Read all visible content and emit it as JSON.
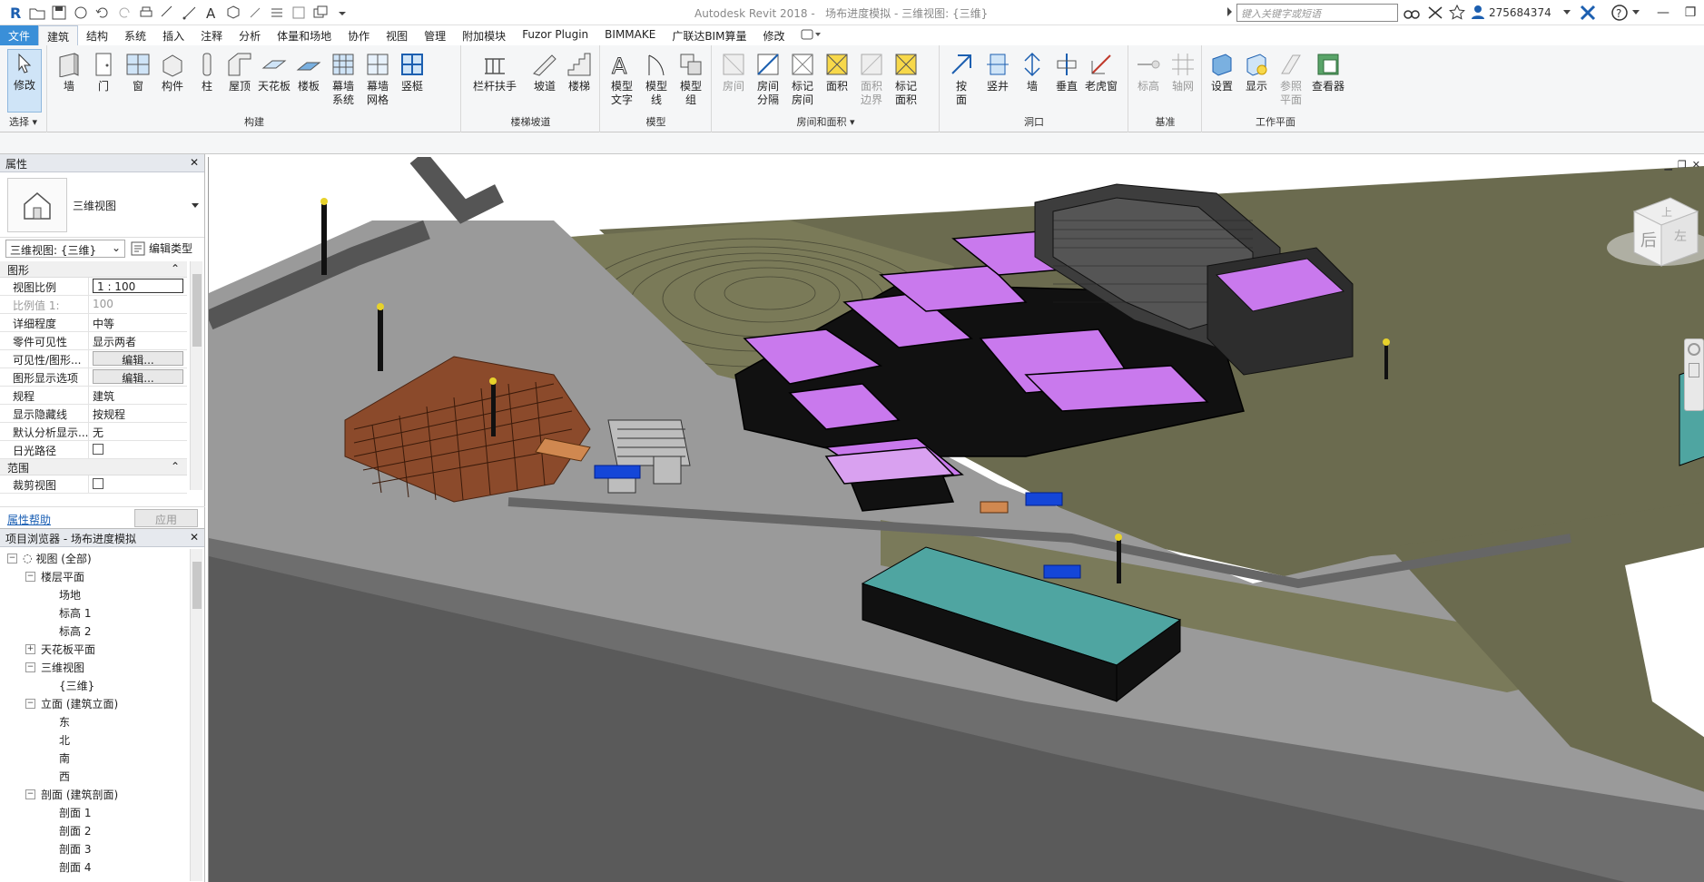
{
  "title": {
    "app": "Autodesk Revit 2018 -",
    "document": "场布进度模拟 - 三维视图: {三维}",
    "search_placeholder": "键入关键字或短语",
    "user": "275684374"
  },
  "menu": [
    "文件",
    "建筑",
    "结构",
    "系统",
    "插入",
    "注释",
    "分析",
    "体量和场地",
    "协作",
    "视图",
    "管理",
    "附加模块",
    "Fuzor Plugin",
    "BIMMAKE",
    "广联达BIM算量",
    "修改"
  ],
  "ribbon": {
    "groups": {
      "select": "选择",
      "build": "构建",
      "stair": "楼梯坡道",
      "model": "模型",
      "room": "房间和面积",
      "opening": "洞口",
      "datum": "基准",
      "workplane": "工作平面"
    },
    "buttons": {
      "modify": "修改",
      "wall": "墙",
      "door": "门",
      "window": "窗",
      "component": "构件",
      "column": "柱",
      "roof": "屋顶",
      "ceiling": "天花板",
      "floor": "楼板",
      "curtain_system": "幕墙\n系统",
      "curtain_grid": "幕墙\n网格",
      "mullion": "竖梃",
      "railing": "栏杆扶手",
      "ramp": "坡道",
      "stair": "楼梯",
      "model_text": "模型\n文字",
      "model_line": "模型\n线",
      "model_group": "模型\n组",
      "room": "房间",
      "room_sep": "房间\n分隔",
      "tag_room": "标记\n房间",
      "area": "面积",
      "area_boundary": "面积\n边界",
      "tag_area": "标记\n面积",
      "by_face": "按\n面",
      "shaft": "竖井",
      "wall_opening": "墙",
      "vertical": "垂直",
      "dormer": "老虎窗",
      "level": "标高",
      "grid": "轴网",
      "set": "设置",
      "show": "显示",
      "ref_plane": "参照\n平面",
      "viewer": "查看器"
    }
  },
  "properties": {
    "title": "属性",
    "type_name": "三维视图",
    "view_selector": "三维视图: {三维}",
    "edit_type": "编辑类型",
    "sections": [
      "图形",
      "范围"
    ],
    "rows": [
      {
        "k": "视图比例",
        "v": "1 : 100"
      },
      {
        "k": "比例值 1:",
        "v": "100"
      },
      {
        "k": "详细程度",
        "v": "中等"
      },
      {
        "k": "零件可见性",
        "v": "显示两者"
      },
      {
        "k": "可见性/图形...",
        "v": "编辑..."
      },
      {
        "k": "图形显示选项",
        "v": "编辑..."
      },
      {
        "k": "规程",
        "v": "建筑"
      },
      {
        "k": "显示隐藏线",
        "v": "按规程"
      },
      {
        "k": "默认分析显示...",
        "v": "无"
      },
      {
        "k": "日光路径",
        "v": ""
      },
      {
        "k": "裁剪视图",
        "v": ""
      }
    ],
    "help": "属性帮助",
    "apply": "应用"
  },
  "browser": {
    "title": "项目浏览器 - 场布进度模拟",
    "nodes": [
      {
        "label": "视图 (全部)",
        "level": 0,
        "toggle": "−"
      },
      {
        "label": "楼层平面",
        "level": 1,
        "toggle": "−"
      },
      {
        "label": "场地",
        "level": 2
      },
      {
        "label": "标高 1",
        "level": 2
      },
      {
        "label": "标高 2",
        "level": 2
      },
      {
        "label": "天花板平面",
        "level": 1,
        "toggle": "+"
      },
      {
        "label": "三维视图",
        "level": 1,
        "toggle": "−"
      },
      {
        "label": "{三维}",
        "level": 2
      },
      {
        "label": "立面 (建筑立面)",
        "level": 1,
        "toggle": "−"
      },
      {
        "label": "东",
        "level": 2
      },
      {
        "label": "北",
        "level": 2
      },
      {
        "label": "南",
        "level": 2
      },
      {
        "label": "西",
        "level": 2
      },
      {
        "label": "剖面 (建筑剖面)",
        "level": 1,
        "toggle": "−"
      },
      {
        "label": "剖面 1",
        "level": 2
      },
      {
        "label": "剖面 2",
        "level": 2
      },
      {
        "label": "剖面 3",
        "level": 2
      },
      {
        "label": "剖面 4",
        "level": 2
      }
    ]
  },
  "viewcube": {
    "top": "上",
    "left": "后",
    "right": "左"
  }
}
